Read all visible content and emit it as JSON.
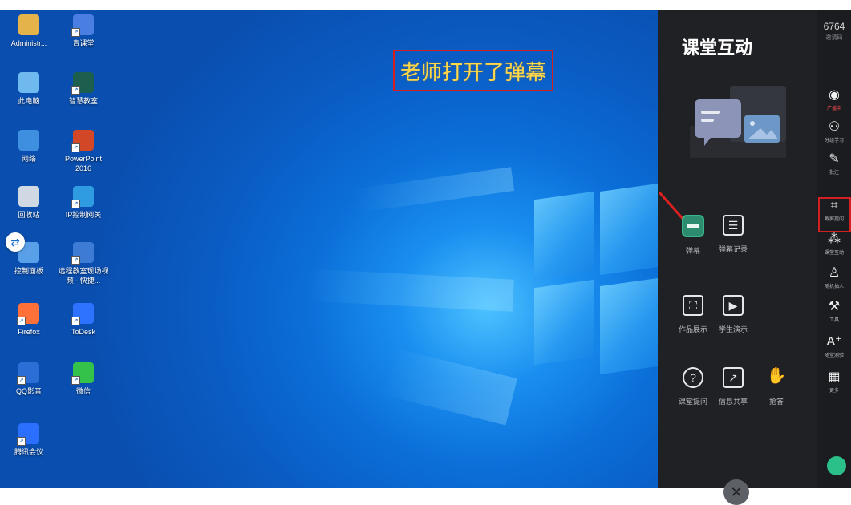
{
  "desktop": {
    "annotation": "老师打开了弹幕",
    "icons": [
      {
        "label": "Administr...",
        "icon": "user-folder-icon",
        "color": "#e4b34a"
      },
      {
        "label": "青课堂",
        "icon": "qingketang-app-icon",
        "color": "#4a7ee0"
      },
      {
        "label": "此电脑",
        "icon": "computer-icon",
        "color": "#6fb9ef"
      },
      {
        "label": "智慧教室",
        "icon": "smart-classroom-icon",
        "color": "#1d5f4e"
      },
      {
        "label": "网络",
        "icon": "network-icon",
        "color": "#3e8fe0"
      },
      {
        "label": "PowerPoint 2016",
        "icon": "powerpoint-icon",
        "color": "#d24726"
      },
      {
        "label": "回收站",
        "icon": "recycle-bin-icon",
        "color": "#cfd8e3"
      },
      {
        "label": "IP控制网关",
        "icon": "globe-icon",
        "color": "#2f9be0"
      },
      {
        "label": "控制面板",
        "icon": "control-panel-icon",
        "color": "#5aa0e8"
      },
      {
        "label": "远程教室现场视频 - 快捷...",
        "icon": "remote-classroom-icon",
        "color": "#3e7bd4"
      },
      {
        "label": "Firefox",
        "icon": "firefox-icon",
        "color": "#ff7139"
      },
      {
        "label": "ToDesk",
        "icon": "todesk-icon",
        "color": "#2e73ff"
      },
      {
        "label": "QQ影音",
        "icon": "qq-player-icon",
        "color": "#2b6fd6"
      },
      {
        "label": "微信",
        "icon": "wechat-icon",
        "color": "#34c24b"
      },
      {
        "label": "腾讯会议",
        "icon": "tencent-meeting-icon",
        "color": "#2b6fff"
      }
    ]
  },
  "panel": {
    "title": "课堂互动",
    "tools": [
      {
        "label": "弹幕",
        "icon": "danmaku-icon",
        "active": true
      },
      {
        "label": "弹幕记录",
        "icon": "danmaku-record-icon",
        "active": false
      },
      {
        "label": "作品展示",
        "icon": "image-showcase-icon",
        "active": false
      },
      {
        "label": "学生演示",
        "icon": "play-screen-icon",
        "active": false
      },
      {
        "label": "课堂提问",
        "icon": "question-icon",
        "active": false
      },
      {
        "label": "信息共享",
        "icon": "share-icon",
        "active": false
      },
      {
        "label": "抢答",
        "icon": "hand-raise-icon",
        "active": false
      }
    ]
  },
  "rail": {
    "code": "6764",
    "code_label": "邀请码",
    "items": [
      {
        "label": "广播中",
        "glyph": "◉",
        "icon": "broadcast-icon",
        "live": true
      },
      {
        "label": "分组学习",
        "glyph": "⚇",
        "icon": "group-icon",
        "live": false
      },
      {
        "label": "批注",
        "glyph": "✎",
        "icon": "annotate-icon",
        "live": false
      },
      {
        "label": "截屏提问",
        "glyph": "⌗",
        "icon": "crop-icon",
        "live": false
      },
      {
        "label": "课堂互动",
        "glyph": "⁂",
        "icon": "interaction-icon",
        "live": false
      },
      {
        "label": "随机抽人",
        "glyph": "♙",
        "icon": "random-pick-icon",
        "live": false
      },
      {
        "label": "工具",
        "glyph": "⚒",
        "icon": "wrench-icon",
        "live": false
      },
      {
        "label": "随堂测验",
        "glyph": "A⁺",
        "icon": "quiz-icon",
        "live": false
      },
      {
        "label": "更多",
        "glyph": "▦",
        "icon": "more-grid-icon",
        "live": false
      }
    ]
  },
  "colors": {
    "accent": "#2d8c6f",
    "live": "#ff4d4f",
    "highlight": "#d42020"
  }
}
